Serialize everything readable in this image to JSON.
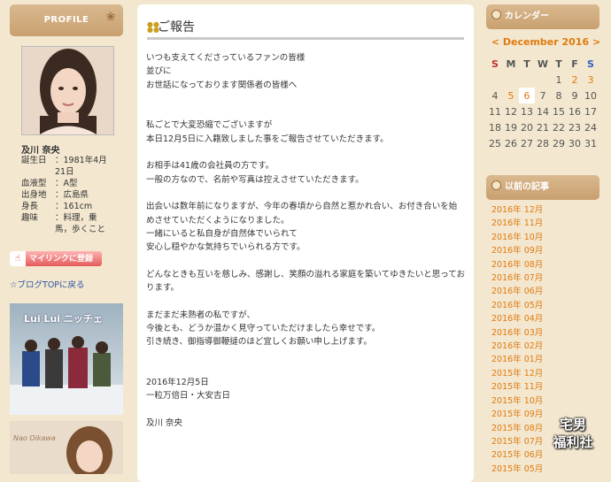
{
  "profile": {
    "header": "PROFILE",
    "name": "及川 奈央",
    "rows": [
      {
        "key": "誕生日",
        "val": "：1981年4月21日"
      },
      {
        "key": "血液型",
        "val": "：A型"
      },
      {
        "key": "出身地",
        "val": "：広島県"
      },
      {
        "key": "身長",
        "val": "：161cm"
      },
      {
        "key": "趣味",
        "val": "：料理，乗馬，歩くこと"
      }
    ],
    "mylink_label": "マイリンクに登録",
    "top_link": "☆ブログTOPに戻る",
    "cd1_text": "Lui Lui ニッチェ",
    "cd2_text": "Nao Oikawa"
  },
  "post": {
    "title": "ご報告",
    "paragraphs": [
      [
        "いつも支えてくださっているファンの皆様",
        "並びに",
        "お世話になっております関係者の皆様へ"
      ],
      [
        "私ごとで大変恐縮でございますが",
        "本日12月5日に入籍致しました事をご報告させていただきます。"
      ],
      [
        "お相手は41歳の会社員の方です。",
        "一般の方なので、名前や写真は控えさせていただきます。"
      ],
      [
        "出会いは数年前になりますが、今年の春頃から自然と惹かれ合い、お付き合いを始めさせていただくようになりました。",
        "一緒にいると私自身が自然体でいられて",
        "安心し穏やかな気持ちでいられる方です。"
      ],
      [
        "どんなときも互いを慈しみ、感謝し、笑顔の溢れる家庭を築いてゆきたいと思っております。"
      ],
      [
        "まだまだ未熟者の私ですが、",
        "今後とも、どうか温かく見守っていただけましたら幸せです。",
        "引き続き、御指導御鞭撻のほど宜しくお願い申し上げます。"
      ],
      [
        "2016年12月5日",
        "一粒万倍日・大安吉日"
      ],
      [
        "及川 奈央"
      ]
    ]
  },
  "calendar": {
    "header": "カレンダー",
    "month_label": "< December 2016 >",
    "weekdays": [
      "S",
      "M",
      "T",
      "W",
      "T",
      "F",
      "S"
    ],
    "weeks": [
      [
        "",
        "",
        "",
        "",
        "1",
        "2",
        "3"
      ],
      [
        "4",
        "5",
        "6",
        "7",
        "8",
        "9",
        "10"
      ],
      [
        "11",
        "12",
        "13",
        "14",
        "15",
        "16",
        "17"
      ],
      [
        "18",
        "19",
        "20",
        "21",
        "22",
        "23",
        "24"
      ],
      [
        "25",
        "26",
        "27",
        "28",
        "29",
        "30",
        "31"
      ]
    ],
    "highlighted": [
      "2",
      "3",
      "5"
    ],
    "today": "6"
  },
  "archive": {
    "header": "以前の記事",
    "items": [
      "2016年 12月",
      "2016年 11月",
      "2016年 10月",
      "2016年 09月",
      "2016年 08月",
      "2016年 07月",
      "2016年 06月",
      "2016年 05月",
      "2016年 04月",
      "2016年 03月",
      "2016年 02月",
      "2016年 01月",
      "2015年 12月",
      "2015年 11月",
      "2015年 10月",
      "2015年 09月",
      "2015年 08月",
      "2015年 07月",
      "2015年 06月",
      "2015年 05月"
    ]
  },
  "watermark": {
    "line1": "宅男",
    "line2": "福利社"
  }
}
